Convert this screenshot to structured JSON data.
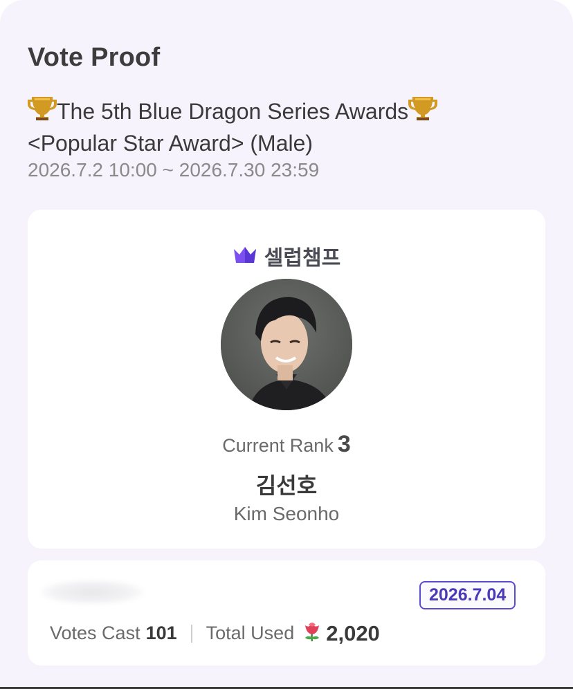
{
  "page_title": "Vote Proof",
  "event": {
    "name_line1": "The 5th Blue Dragon Series Awards",
    "name_line2": "<Popular Star Award> (Male)",
    "dates": "2026.7.2 10:00 ~ 2026.7.30 23:59",
    "trophy_icon": "trophy-icon"
  },
  "brand": {
    "name": "셀럽챔프",
    "icon": "crown-icon",
    "color": "#7b4ff0"
  },
  "candidate": {
    "rank_label": "Current Rank",
    "rank": "3",
    "name_kr": "김선호",
    "name_en": "Kim Seonho"
  },
  "vote": {
    "date": "2026.7.04",
    "votes_cast_label": "Votes Cast",
    "votes_cast": "101",
    "total_used_label": "Total Used",
    "total_used": "2,020",
    "currency_icon": "rose-icon"
  },
  "colors": {
    "background": "#f6f3fc",
    "card": "#ffffff",
    "badge_border": "#5a4ad0",
    "badge_text": "#4a3ab8"
  }
}
